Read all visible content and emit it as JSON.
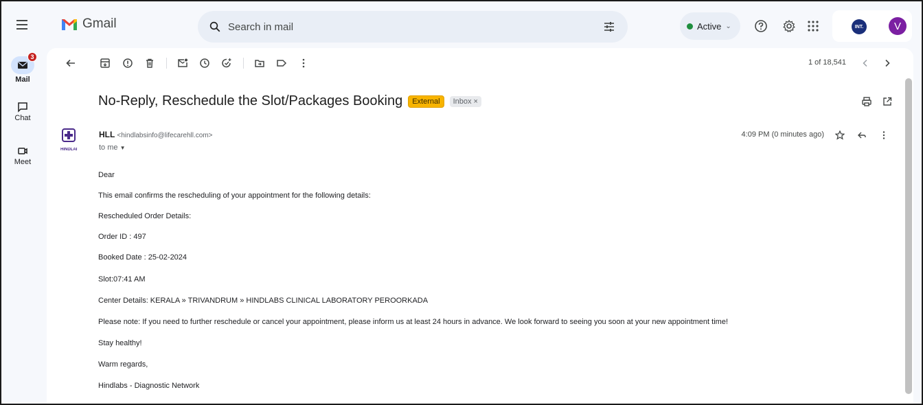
{
  "app": {
    "name": "Gmail"
  },
  "search": {
    "placeholder": "Search in mail"
  },
  "status": {
    "label": "Active"
  },
  "account": {
    "org_badge": "INT.",
    "avatar_letter": "V"
  },
  "rail": {
    "mail": {
      "label": "Mail",
      "badge": "3"
    },
    "chat": {
      "label": "Chat"
    },
    "meet": {
      "label": "Meet"
    }
  },
  "toolbar": {
    "count": "1 of 18,541"
  },
  "email": {
    "subject": "No-Reply, Reschedule the Slot/Packages Booking",
    "labels": {
      "external": "External",
      "inbox": "Inbox ×"
    },
    "sender": {
      "name": "HLL",
      "email": "<hindlabsinfo@lifecarehll.com>",
      "logo_text": "HINDLABS"
    },
    "to": "to me",
    "time": "4:09 PM (0 minutes ago)",
    "body": [
      "Dear",
      "This email confirms the rescheduling of your appointment for the following details:",
      "Rescheduled Order Details:",
      "Order ID : 497",
      "Booked Date : 25-02-2024",
      "Slot:07:41 AM",
      "Center Details: KERALA » TRIVANDRUM » HINDLABS CLINICAL LABORATORY PEROORKADA",
      "Please note: If you need to further reschedule or cancel your appointment, please inform us at least 24 hours in advance. We look forward to seeing you soon at your new appointment time!",
      "Stay healthy!",
      "Warm regards,",
      "Hindlabs - Diagnostic Network"
    ]
  },
  "colors": {
    "accent": "#d3e3fd",
    "external_chip": "#f8b400",
    "avatar": "#7b1fa2",
    "active_dot": "#1e8e3e"
  }
}
